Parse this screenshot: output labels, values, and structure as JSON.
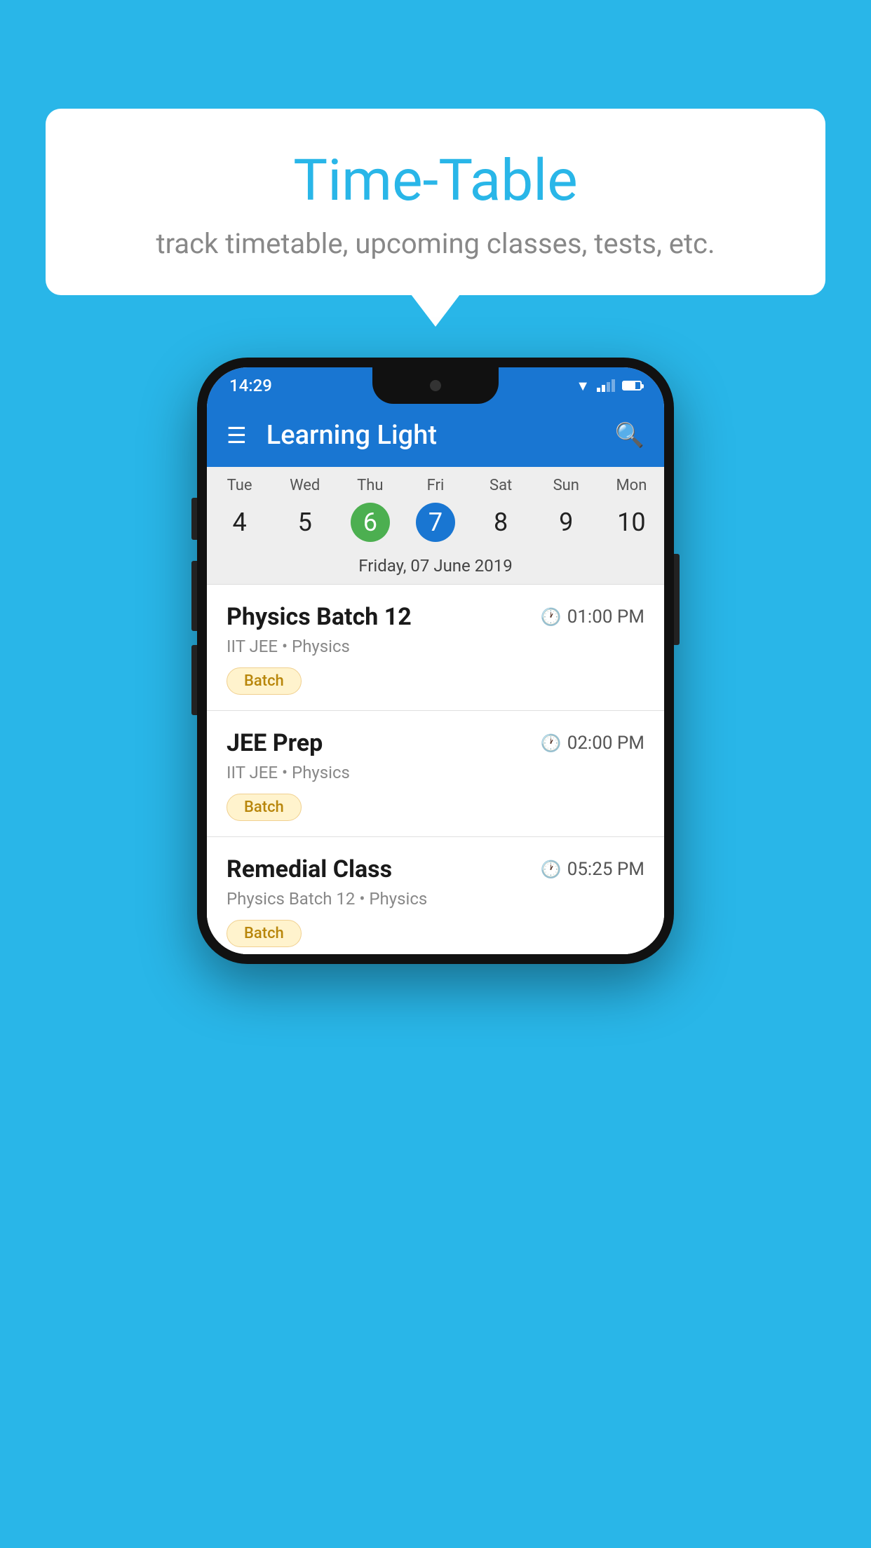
{
  "background_color": "#29b6e8",
  "bubble": {
    "title": "Time-Table",
    "subtitle": "track timetable, upcoming classes, tests, etc."
  },
  "status_bar": {
    "time": "14:29"
  },
  "app_bar": {
    "title": "Learning Light"
  },
  "calendar": {
    "days": [
      {
        "name": "Tue",
        "num": "4",
        "state": "normal"
      },
      {
        "name": "Wed",
        "num": "5",
        "state": "normal"
      },
      {
        "name": "Thu",
        "num": "6",
        "state": "today"
      },
      {
        "name": "Fri",
        "num": "7",
        "state": "selected"
      },
      {
        "name": "Sat",
        "num": "8",
        "state": "normal"
      },
      {
        "name": "Sun",
        "num": "9",
        "state": "normal"
      },
      {
        "name": "Mon",
        "num": "10",
        "state": "normal"
      }
    ],
    "selected_date_label": "Friday, 07 June 2019"
  },
  "schedule": [
    {
      "title": "Physics Batch 12",
      "time": "01:00 PM",
      "subtitle": "IIT JEE • Physics",
      "tag": "Batch"
    },
    {
      "title": "JEE Prep",
      "time": "02:00 PM",
      "subtitle": "IIT JEE • Physics",
      "tag": "Batch"
    },
    {
      "title": "Remedial Class",
      "time": "05:25 PM",
      "subtitle": "Physics Batch 12 • Physics",
      "tag": "Batch"
    }
  ],
  "icons": {
    "hamburger": "☰",
    "search": "🔍",
    "clock": "🕐"
  }
}
